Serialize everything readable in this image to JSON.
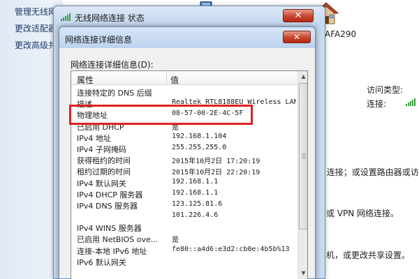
{
  "background": {
    "sidebar_links": [
      "管理无线网络",
      "更改适配器",
      "更改高级共"
    ],
    "network_name": "AFA290",
    "access_type_label": "访问类型:",
    "connection_label": "连接:",
    "text_line_1": "N 连接；或设置路由器或访",
    "text_line_2": "号或 VPN 网络连接。",
    "text_line_3": "印机，或更改共享设置。"
  },
  "outer_window": {
    "title": "无线网络连接 状态",
    "close_symbol": "✕"
  },
  "inner_window": {
    "title": "网络连接详细信息",
    "close_symbol": "✕",
    "group_label": "网络连接详细信息(D):",
    "columns": {
      "property": "属性",
      "value": "值"
    },
    "rows": [
      {
        "property": "连接特定的 DNS 后缀",
        "value": ""
      },
      {
        "property": "描述",
        "value": "Realtek RTL8188EU Wireless LAN"
      },
      {
        "property": "物理地址",
        "value": "08-57-00-2E-4C-5F"
      },
      {
        "property": "已启用 DHCP",
        "value": "是"
      },
      {
        "property": "IPv4 地址",
        "value": "192.168.1.104"
      },
      {
        "property": "IPv4 子网掩码",
        "value": "255.255.255.0"
      },
      {
        "property": "获得租约的时间",
        "value": "2015年10月2日 17:20:19"
      },
      {
        "property": "租约过期的时间",
        "value": "2015年10月2日 22:20:19"
      },
      {
        "property": "IPv4 默认网关",
        "value": "192.168.1.1"
      },
      {
        "property": "IPv4 DHCP 服务器",
        "value": "192.168.1.1"
      },
      {
        "property": "IPv4 DNS 服务器",
        "value": "123.125.81.6"
      },
      {
        "property": "",
        "value": "101.226.4.6"
      },
      {
        "property": "IPv4 WINS 服务器",
        "value": ""
      },
      {
        "property": "已启用 NetBIOS ove...",
        "value": "是"
      },
      {
        "property": "连接-本地 IPv6 地址",
        "value": "fe80::a4d6:e3d2:cb0e:4b5b%13"
      },
      {
        "property": "IPv6 默认网关",
        "value": ""
      }
    ]
  },
  "colors": {
    "highlight": "#e02020",
    "close_button": "#c8442d",
    "window_frame": "#c9daef"
  },
  "icons": {
    "title_icon": "wifi-signal-icon",
    "house": "house-icon",
    "network": "network-icon"
  }
}
